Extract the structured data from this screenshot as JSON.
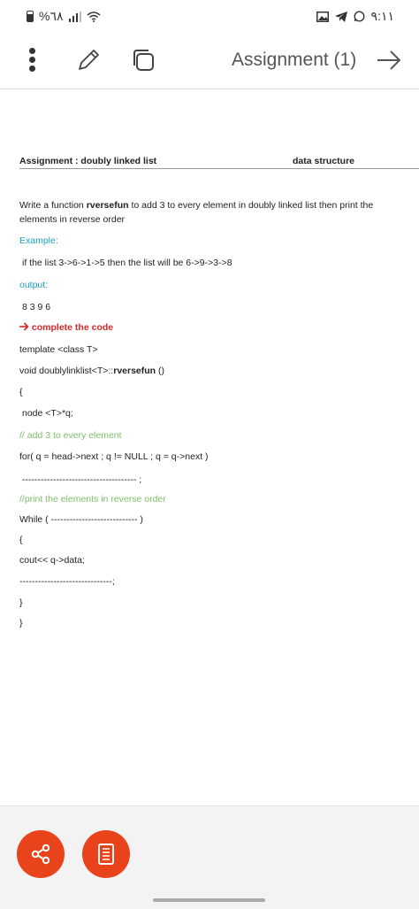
{
  "status": {
    "battery": "%٦٨",
    "time": "٩:١١"
  },
  "toolbar": {
    "title": "Assignment (1)"
  },
  "doc": {
    "header_left": "Assignment : doubly linked list",
    "header_right": "data  structure",
    "q_line1_pre": "Write a function ",
    "q_line1_bold": "rversefun",
    "q_line1_post": " to add 3 to every element in doubly linked list then print the",
    "q_line2": "elements in reverse order",
    "example_label": "Example:",
    "example_text": "if the list   3->6->1->5      then the list will be   6->9->3->8",
    "output_label": "output:",
    "output_value": "8 3 9 6",
    "complete_label": "complete the code",
    "code_template": "template <class T>",
    "code_sig_pre": "void doublylinklist<T>::",
    "code_sig_bold": "rversefun",
    "code_sig_post": " ()",
    "code_open1": "{",
    "code_node": "node <T>*q;",
    "comment_add": "//  add 3 to every element",
    "code_for": "for( q = head->next ; q != NULL ; q = q->next )",
    "code_blank1": "-------------------------------------     ;",
    "comment_print": "//print the elements in reverse order",
    "code_while": "While ( ---------------------------- )",
    "code_open2": "{",
    "code_cout": "cout<< q->data;",
    "code_blank2": "------------------------------;",
    "code_close1": "}",
    "code_close2": "}"
  }
}
